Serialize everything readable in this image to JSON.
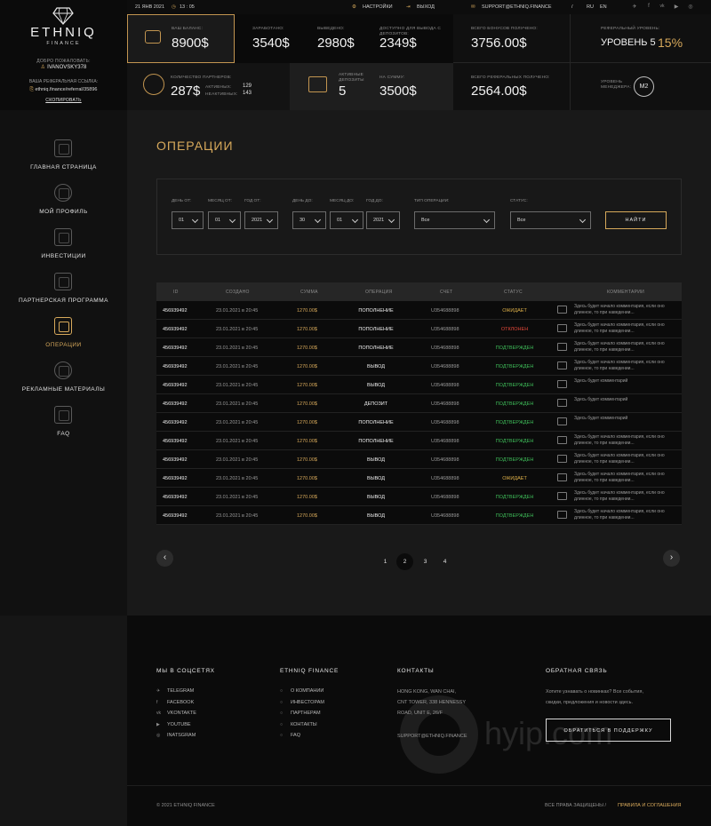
{
  "brand": {
    "name": "ETHNIQ",
    "sub": "FINANCE"
  },
  "user": {
    "welcome": "ДОБРО ПОЖАЛОВАТЬ:",
    "username": "IVANOVSKY378",
    "ref_label": "ВАША РЕФЕРАЛЬНАЯ ССЫЛКА:",
    "ref_link": "ethniq.finance/referral/35896",
    "copy": "СКОПИРОВАТЬ"
  },
  "topbar": {
    "date": "21 ЯНВ 2021",
    "time": "13 : 05",
    "settings": "НАСТРОЙКИ",
    "logout": "ВЫХОД",
    "email": "SUPPORT@ETHNIQ.FINANCE",
    "lang_ru": "RU",
    "lang_sep": "/",
    "lang_en": "EN",
    "socials": [
      "✈",
      "f",
      "vk",
      "▶",
      "◎"
    ]
  },
  "stats": {
    "balance_label": "ВАШ БАЛАНС:",
    "balance": "8900$",
    "earned_label": "ЗАРАБОТАНО:",
    "earned": "3540$",
    "withdrawn_label": "ВЫВЕДЕНО:",
    "withdrawn": "2980$",
    "available_label": "ДОСТУПНО ДЛЯ ВЫВОДА С ДЕПОЗИТОВ:",
    "available": "2349$",
    "bonus_label": "ВСЕГО БОНУСОВ ПОЛУЧЕНО:",
    "bonus": "3756.00$",
    "ref_level_label": "РЕФЕРАЛЬНЫЙ УРОВЕНЬ:",
    "ref_level": "УРОВЕНЬ 5",
    "ref_percent": "15%",
    "partners_label": "КОЛИЧЕСТВО ПАРТНЕРОВ:",
    "partners": "287$",
    "active_label": "АКТИВНЫХ:",
    "active": "129",
    "inactive_label": "НЕАКТИВНЫХ:",
    "inactive": "143",
    "active_deposits_label": "АКТИВНЫЕ ДЕПОЗИТЫ",
    "active_deposits": "5",
    "sum_label": "НА СУММУ:",
    "sum": "3500$",
    "ref_total_label": "ВСЕГО РЕФЕРАЛЬНЫХ ПОЛУЧЕНО:",
    "ref_total": "2564.00$",
    "manager_label": "УРОВЕНЬ МЕНЕДЖЕРА:",
    "manager": "M2"
  },
  "nav": [
    {
      "label": "ГЛАВНАЯ СТРАНИЦА"
    },
    {
      "label": "МОЙ ПРОФИЛЬ"
    },
    {
      "label": "ИНВЕСТИЦИИ"
    },
    {
      "label": "ПАРТНЕРСКАЯ ПРОГРАММА"
    },
    {
      "label": "ОПЕРАЦИИ"
    },
    {
      "label": "РЕКЛАМНЫЕ МАТЕРИАЛЫ"
    },
    {
      "label": "FAQ"
    }
  ],
  "page_title": "ОПЕРАЦИИ",
  "filters": {
    "day_from": {
      "label": "ДЕНЬ ОТ:",
      "value": "01"
    },
    "month_from": {
      "label": "МЕСЯЦ ОТ:",
      "value": "01"
    },
    "year_from": {
      "label": "ГОД ОТ:",
      "value": "2021"
    },
    "day_to": {
      "label": "ДЕНЬ ДО:",
      "value": "30"
    },
    "month_to": {
      "label": "МЕСЯЦ ДО:",
      "value": "01"
    },
    "year_to": {
      "label": "ГОД ДО:",
      "value": "2021"
    },
    "op_type": {
      "label": "ТИП ОПЕРАЦИИ:",
      "value": "Все"
    },
    "status": {
      "label": "СТАТУС:",
      "value": "Все"
    },
    "find": "НАЙТИ"
  },
  "table": {
    "headers": [
      "ID",
      "СОЗДАНО",
      "СУММА",
      "ОПЕРАЦИЯ",
      "СЧЕТ",
      "СТАТУС",
      "КОММЕНТАРИИ"
    ],
    "rows": [
      {
        "id": "456939492",
        "created": "23.01.2021 в 20:45",
        "sum": "1270.00$",
        "op": "ПОПОЛНЕНИЕ",
        "account": "U354688898",
        "status": "ОЖИДАЕТ",
        "comment": "Здесь будет начало комментария, если оно длинное, то при наведении..."
      },
      {
        "id": "456939492",
        "created": "23.01.2021 в 20:45",
        "sum": "1270.00$",
        "op": "ПОПОЛНЕНИЕ",
        "account": "U354688898",
        "status": "ОТКЛОНЕН",
        "comment": "Здесь будет начало комментария, если оно длинное, то при наведении..."
      },
      {
        "id": "456939492",
        "created": "23.01.2021 в 20:45",
        "sum": "1270.00$",
        "op": "ПОПОЛНЕНИЕ",
        "account": "U354688898",
        "status": "ПОДТВЕРЖДЕН",
        "comment": "Здесь будет начало комментария, если оно длинное, то при наведении..."
      },
      {
        "id": "456939492",
        "created": "23.01.2021 в 20:45",
        "sum": "1270.00$",
        "op": "ВЫВОД",
        "account": "U354688898",
        "status": "ПОДТВЕРЖДЕН",
        "comment": "Здесь будет начало комментария, если оно длинное, то при наведении..."
      },
      {
        "id": "456939492",
        "created": "23.01.2021 в 20:45",
        "sum": "1270.00$",
        "op": "ВЫВОД",
        "account": "U354688898",
        "status": "ПОДТВЕРЖДЕН",
        "comment": "Здесь будет комментарий"
      },
      {
        "id": "456939492",
        "created": "23.01.2021 в 20:45",
        "sum": "1270.00$",
        "op": "ДЕПОЗИТ",
        "account": "U354688898",
        "status": "ПОДТВЕРЖДЕН",
        "comment": "Здесь будет комментарий"
      },
      {
        "id": "456939492",
        "created": "23.01.2021 в 20:45",
        "sum": "1270.00$",
        "op": "ПОПОЛНЕНИЕ",
        "account": "U354688898",
        "status": "ПОДТВЕРЖДЕН",
        "comment": "Здесь будет комментарий"
      },
      {
        "id": "456939492",
        "created": "23.01.2021 в 20:45",
        "sum": "1270.00$",
        "op": "ПОПОЛНЕНИЕ",
        "account": "U354688898",
        "status": "ПОДТВЕРЖДЕН",
        "comment": "Здесь будет начало комментария, если оно длинное, то при наведении..."
      },
      {
        "id": "456939492",
        "created": "23.01.2021 в 20:45",
        "sum": "1270.00$",
        "op": "ВЫВОД",
        "account": "U354688898",
        "status": "ПОДТВЕРЖДЕН",
        "comment": "Здесь будет начало комментария, если оно длинное, то при наведении..."
      },
      {
        "id": "456939492",
        "created": "23.01.2021 в 20:45",
        "sum": "1270.00$",
        "op": "ВЫВОД",
        "account": "U354688898",
        "status": "ОЖИДАЕТ",
        "comment": "Здесь будет начало комментария, если оно длинное, то при наведении..."
      },
      {
        "id": "456939492",
        "created": "23.01.2021 в 20:45",
        "sum": "1270.00$",
        "op": "ВЫВОД",
        "account": "U354688898",
        "status": "ПОДТВЕРЖДЕН",
        "comment": "Здесь будет начало комментария, если оно длинное, то при наведении..."
      },
      {
        "id": "456939492",
        "created": "23.01.2021 в 20:45",
        "sum": "1270.00$",
        "op": "ВЫВОД",
        "account": "U354688898",
        "status": "ПОДТВЕРЖДЕН",
        "comment": "Здесь будет начало комментария, если оно длинное, то при наведении..."
      }
    ]
  },
  "status_colors": {
    "ОЖИДАЕТ": "#e0b24a",
    "ОТКЛОНЕН": "#e5493a",
    "ПОДТВЕРЖДЕН": "#3fbf5a"
  },
  "pagination": {
    "prev": "‹",
    "next": "›",
    "pages": [
      "1",
      "2",
      "3",
      "4"
    ],
    "current": "2"
  },
  "footer": {
    "social_title": "МЫ В СОЦСЕТЯХ",
    "social": [
      {
        "icon": "✈",
        "label": "TELEGRAM"
      },
      {
        "icon": "f",
        "label": "FACEBOOK"
      },
      {
        "icon": "vk",
        "label": "VKONTAKTE"
      },
      {
        "icon": "▶",
        "label": "YOUTUBE"
      },
      {
        "icon": "◎",
        "label": "INATSGRAM"
      }
    ],
    "company_title": "ETHNIQ FINANCE",
    "company": [
      "О КОМПАНИИ",
      "ИНВЕСТОРАМ",
      "ПАРТНЕРАМ",
      "КОНТАКТЫ",
      "FAQ"
    ],
    "contacts_title": "КОНТАКТЫ",
    "address": [
      "HONG KONG, WAN CHAI,",
      "CNT TOWER, 338 HENNESSY",
      "ROAD, UNIT E, 26/F"
    ],
    "contact_email": "SUPPORT@ETHNIQ.FINANCE",
    "feedback_title": "ОБРАТНАЯ СВЯЗЬ",
    "feedback_text": [
      "Хотите узнавать о новинках? Все события,",
      "скидки, предложения и новости здесь."
    ],
    "support_button": "ОБРАТИТЬСЯ В ПОДДЕРЖКУ",
    "copyright": "© 2021 ETHNIQ FINANCE",
    "rights": "ВСЕ ПРАВА ЗАЩИЩЕНЫ   /",
    "rules": "ПРАВИЛА И СОГЛАШЕНИЯ",
    "watermark": "hyip.com"
  }
}
